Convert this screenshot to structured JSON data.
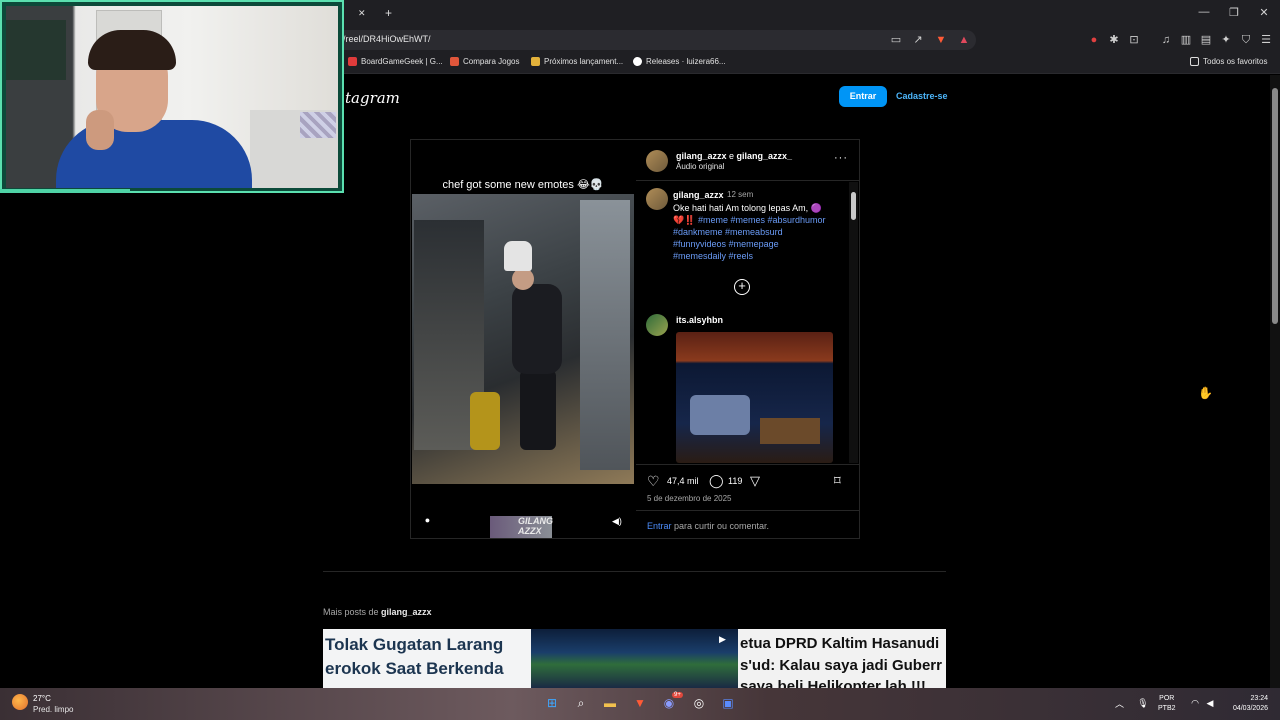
{
  "browser": {
    "url": "/reel/DR4HiOwEhWT/",
    "new_tab": "+",
    "tab_close": "✕",
    "bookmarks": [
      {
        "label": "BoardGameGeek | G...",
        "color": "#e03b3b"
      },
      {
        "label": "Compara Jogos",
        "color": "#e0563b"
      },
      {
        "label": "Próximos lançament...",
        "color": "#e3b23b"
      },
      {
        "label": "Releases · luizera66...",
        "color": "#ffffff"
      }
    ],
    "all_bookmarks": "Todos os favoritos",
    "window_controls": {
      "minimize": "—",
      "restore": "❐",
      "close": "✕"
    }
  },
  "instagram": {
    "logo": "tagram",
    "login_button": "Entrar",
    "signup_button": "Cadastre-se",
    "post": {
      "video_caption": "chef got some new emotes 😂💀",
      "watermark": "GILANG AZZX",
      "header_user1": "gilang_azzx",
      "header_joiner": " e ",
      "header_user2": "gilang_azzx_",
      "audio": "Áudio original",
      "more": "···",
      "caption_user": "gilang_azzx",
      "caption_time": "12 sem",
      "caption_text": "Oke hati hati Am tolong lepas Am, 🟣",
      "caption_emoji": "💔‼️",
      "hashtags": [
        "#meme",
        "#memes",
        "#absurdhumor",
        "#dankmeme",
        "#memeabsurd",
        "#funnyvideos",
        "#memepage",
        "#memesdaily",
        "#reels"
      ],
      "comment_user": "its.alsyhbn",
      "likes": "47,4 mil",
      "comments": "119",
      "date": "5 de dezembro de 2025",
      "login_link": "Entrar",
      "login_rest": "para curtir ou comentar."
    },
    "more_posts_prefix": "Mais posts de",
    "more_posts_user": "gilang_azzx",
    "thumbnails": [
      {
        "line1": "Tolak Gugatan Larang",
        "line2": "erokok Saat Berkenda"
      },
      {
        "line1": "",
        "line2": ""
      },
      {
        "line1": "etua DPRD Kaltim Hasanudi",
        "line2": "s'ud: Kalau saya jadi Guberr",
        "line3": "saya beli Helikopter lah   !!!"
      }
    ]
  },
  "taskbar": {
    "temperature": "27°C",
    "condition": "Pred. limpo",
    "lang1": "POR",
    "lang2": "PTB2",
    "time": "23:24",
    "date": "04/03/2026",
    "badge": "9+"
  }
}
